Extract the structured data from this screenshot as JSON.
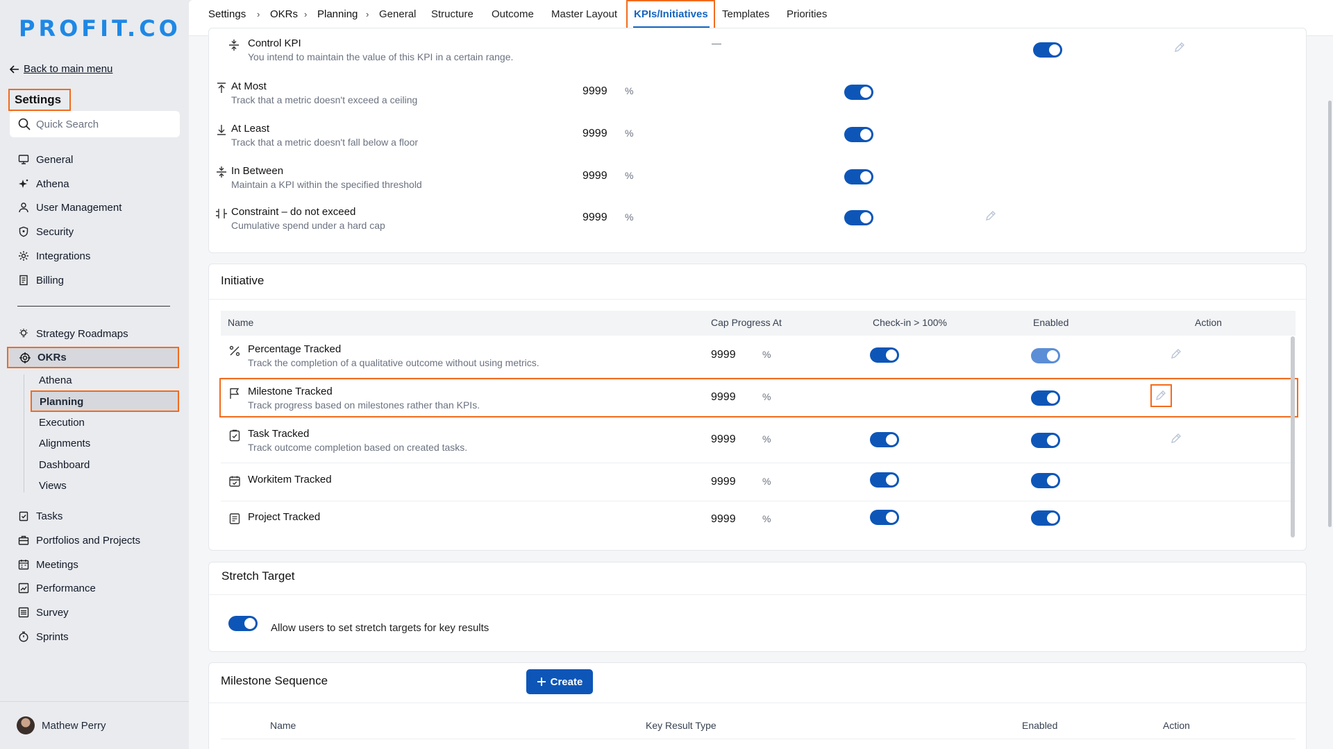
{
  "app": {
    "logo": "PROFIT.CO",
    "accent": "#1565c0",
    "highlight": "#f26b1d"
  },
  "sidebar": {
    "back_label": "Back to main menu",
    "settings_title": "Settings",
    "search_placeholder": "Quick Search",
    "items_top": [
      {
        "label": "General",
        "icon": "monitor-icon"
      },
      {
        "label": "Athena",
        "icon": "sparkle-icon"
      },
      {
        "label": "User Management",
        "icon": "user-icon"
      },
      {
        "label": "Security",
        "icon": "shield-icon"
      },
      {
        "label": "Integrations",
        "icon": "gear-icon"
      },
      {
        "label": "Billing",
        "icon": "receipt-icon"
      }
    ],
    "items_mid": [
      {
        "label": "Strategy Roadmaps",
        "icon": "bulb-icon"
      },
      {
        "label": "OKRs",
        "icon": "target-icon"
      }
    ],
    "okr_sub": [
      "Athena",
      "Planning",
      "Execution",
      "Alignments",
      "Dashboard",
      "Views"
    ],
    "items_bottom": [
      {
        "label": "Tasks",
        "icon": "clipboard-icon"
      },
      {
        "label": "Portfolios and Projects",
        "icon": "briefcase-icon"
      },
      {
        "label": "Meetings",
        "icon": "calendar-icon"
      },
      {
        "label": "Performance",
        "icon": "chart-icon"
      },
      {
        "label": "Survey",
        "icon": "list-icon"
      },
      {
        "label": "Sprints",
        "icon": "timer-icon"
      }
    ],
    "user_name": "Mathew Perry"
  },
  "topbar": {
    "breadcrumbs": [
      "Settings",
      "OKRs",
      "Planning"
    ],
    "tabs": [
      "General",
      "Structure",
      "Outcome",
      "Master Layout",
      "KPIs/Initiatives",
      "Templates",
      "Priorities"
    ],
    "active_tab": "KPIs/Initiatives"
  },
  "kpi": {
    "control": {
      "title": "Control KPI",
      "desc": "You intend to maintain the value of this KPI in a certain range.",
      "value": "—"
    },
    "rows": [
      {
        "title": "At Most",
        "desc": "Track that a metric doesn't exceed a ceiling",
        "value": "9999",
        "unit": "%"
      },
      {
        "title": "At Least",
        "desc": "Track that a metric doesn't fall below a floor",
        "value": "9999",
        "unit": "%"
      },
      {
        "title": "In Between",
        "desc": "Maintain a KPI within the specified threshold",
        "value": "9999",
        "unit": "%"
      },
      {
        "title": "Constraint – do not exceed",
        "desc": "Cumulative spend under a hard cap",
        "value": "9999",
        "unit": "%"
      }
    ]
  },
  "initiative": {
    "title": "Initiative",
    "headers": {
      "name": "Name",
      "cap": "Cap Progress At",
      "checkin": "Check-in > 100%",
      "enabled": "Enabled",
      "action": "Action"
    },
    "rows": [
      {
        "title": "Percentage Tracked",
        "desc": "Track the completion of a qualitative outcome without using metrics.",
        "value": "9999",
        "unit": "%",
        "icon": "percent-icon"
      },
      {
        "title": "Milestone Tracked",
        "desc": "Track progress based on milestones rather than KPIs.",
        "value": "9999",
        "unit": "%",
        "icon": "flag-icon"
      },
      {
        "title": "Task Tracked",
        "desc": "Track outcome completion based on created tasks.",
        "value": "9999",
        "unit": "%",
        "icon": "clipboard-check-icon"
      },
      {
        "title": "Workitem Tracked",
        "desc": "",
        "value": "9999",
        "unit": "%",
        "icon": "calendar-check-icon"
      },
      {
        "title": "Project Tracked",
        "desc": "",
        "value": "9999",
        "unit": "%",
        "icon": "document-icon"
      }
    ]
  },
  "stretch": {
    "title": "Stretch Target",
    "label": "Allow users to set stretch targets for key results"
  },
  "milestone_seq": {
    "title": "Milestone Sequence",
    "create_label": "Create",
    "headers": {
      "name": "Name",
      "kr_type": "Key Result Type",
      "enabled": "Enabled",
      "action": "Action"
    }
  }
}
